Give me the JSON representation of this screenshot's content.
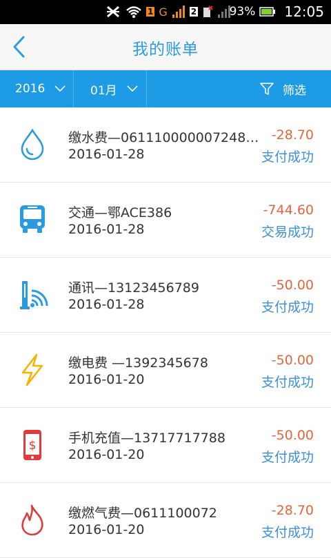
{
  "status_bar": {
    "battery_percent": "93%",
    "time": "12:05",
    "network_label": "G",
    "sim_label": "1",
    "sim2_label": "2"
  },
  "header": {
    "title": "我的账单",
    "back_icon": "chevron-left-icon"
  },
  "filter_bar": {
    "year": "2016",
    "month": "01月",
    "filter_label": "筛选"
  },
  "colors": {
    "accent": "#1d9be4",
    "title": "#2c9be0",
    "amount": "#e8643b",
    "status": "#3b8fdc",
    "water": "#2a9be0",
    "bus": "#2a9be0",
    "telecom": "#2a9be0",
    "electric": "#f4b400",
    "phone": "#e03a3a",
    "gas": "#e03a3a"
  },
  "bills": [
    {
      "icon": "water-drop-icon",
      "name": "缴水费—0611100000072480…",
      "date": "2016-01-28",
      "amount": "-28.70",
      "status": "支付成功"
    },
    {
      "icon": "bus-icon",
      "name": "交通—鄂ACE386",
      "date": "2016-01-28",
      "amount": "-744.60",
      "status": "交易成功"
    },
    {
      "icon": "wifi-router-icon",
      "name": "通讯—13123456789",
      "date": "2016-01-28",
      "amount": "-50.00",
      "status": "支付成功"
    },
    {
      "icon": "lightning-icon",
      "name": "缴电费 —1392345678",
      "date": "2016-01-20",
      "amount": "-50.00",
      "status": "支付成功"
    },
    {
      "icon": "phone-dollar-icon",
      "name": "手机充值—13717717788",
      "date": "2016-01-20",
      "amount": "-50.00",
      "status": "支付成功"
    },
    {
      "icon": "flame-icon",
      "name": "缴燃气费—0611100072",
      "date": "2016-01-20",
      "amount": "-28.70",
      "status": "支付成功"
    }
  ]
}
